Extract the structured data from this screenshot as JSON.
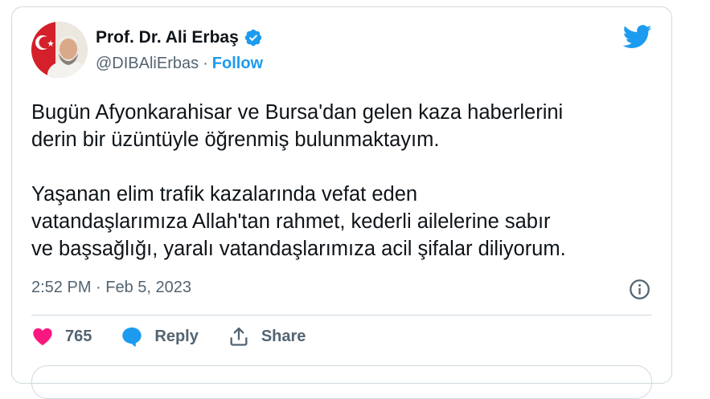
{
  "author": {
    "name": "Prof. Dr. Ali Erbaş",
    "handle": "@DIBAliErbas",
    "separator": "·",
    "follow_label": "Follow"
  },
  "tweet": {
    "text": "Bugün Afyonkarahisar ve Bursa'dan gelen kaza haberlerini\nderin bir üzüntüyle öğrenmiş bulunmaktayım.\n\nYaşanan elim trafik kazalarında vefat eden\nvatandaşlarımıza Allah'tan rahmet, kederli ailelerine sabır\nve başsağlığı, yaralı vatandaşlarımıza acil şifalar diliyorum.",
    "timestamp": "2:52 PM · Feb 5, 2023"
  },
  "actions": {
    "likes_count": "765",
    "reply_label": "Reply",
    "share_label": "Share"
  },
  "icons": {
    "verified": "verified-badge-icon",
    "brand": "twitter-bird-icon",
    "info": "info-icon",
    "like": "heart-icon",
    "reply": "speech-bubble-icon",
    "share": "share-icon"
  },
  "colors": {
    "accent": "#1d9bf0",
    "like": "#f91880",
    "muted": "#536471",
    "text": "#0f1419",
    "border": "#cfd9de"
  }
}
